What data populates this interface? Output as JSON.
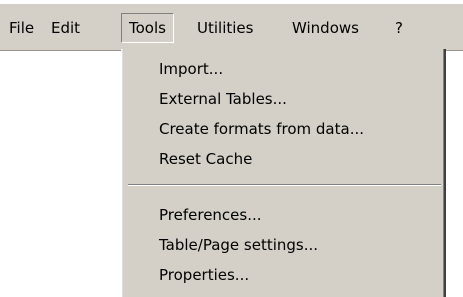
{
  "menubar": {
    "items": [
      {
        "label": "File"
      },
      {
        "label": "Edit"
      },
      {
        "label": "Tools",
        "active": true
      },
      {
        "label": "Utilities"
      },
      {
        "label": "Windows"
      },
      {
        "label": "?"
      }
    ]
  },
  "tools_menu": {
    "items": [
      {
        "label": "Import..."
      },
      {
        "label": "External Tables..."
      },
      {
        "label": "Create formats from data..."
      },
      {
        "label": "Reset Cache"
      },
      {
        "label": "Preferences..."
      },
      {
        "label": "Table/Page settings..."
      },
      {
        "label": "Properties..."
      }
    ]
  },
  "colors": {
    "menu_background": "#d4d0c8",
    "text": "#000000",
    "page_background": "#ffffff"
  }
}
